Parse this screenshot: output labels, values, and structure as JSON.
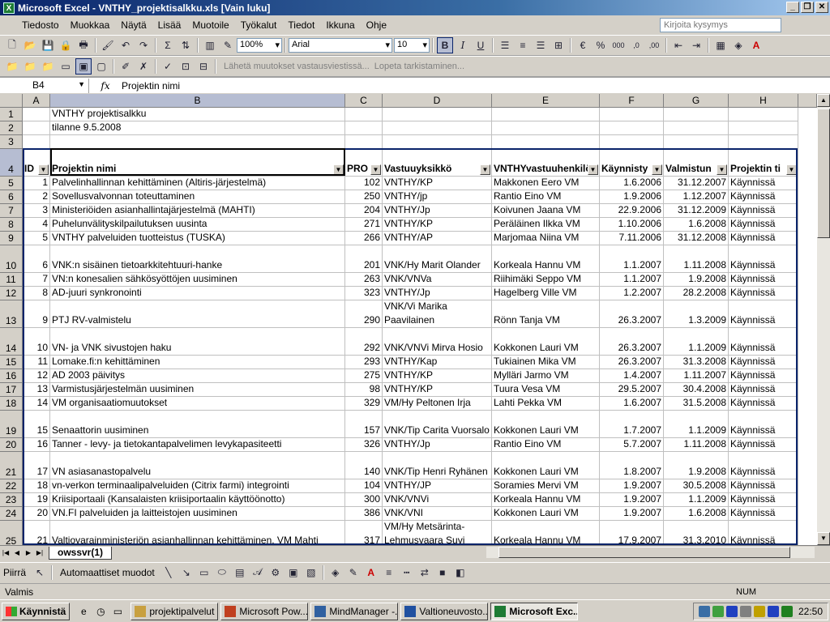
{
  "window": {
    "title": "Microsoft Excel - VNTHY_projektisalkku.xls  [Vain luku]"
  },
  "menu": {
    "items": [
      "Tiedosto",
      "Muokkaa",
      "Näytä",
      "Lisää",
      "Muotoile",
      "Työkalut",
      "Tiedot",
      "Ikkuna",
      "Ohje"
    ],
    "ask_placeholder": "Kirjoita kysymys"
  },
  "toolbar": {
    "zoom": "100%",
    "font": "Arial",
    "size": "10"
  },
  "review": {
    "send_label": "Lähetä muutokset vastausviestissä...",
    "end_label": "Lopeta tarkistaminen..."
  },
  "formula": {
    "cell_ref": "B4",
    "fx": "fx",
    "content": "Projektin nimi"
  },
  "columns": [
    "A",
    "B",
    "C",
    "D",
    "E",
    "F",
    "G",
    "H"
  ],
  "sheet": {
    "title": "VNTHY projektisalkku",
    "date": "tilanne 9.5.2008",
    "headers": [
      "ID",
      "Projektin nimi",
      "PRO",
      "Vastuuyksikkö",
      "VNTHYvastuuhenkilö",
      "Käynnisty",
      "Valmistun",
      "Projektin ti"
    ],
    "rows": [
      {
        "num": "5",
        "id": "1",
        "name": "Palvelinhallinnan kehittäminen (Altiris-järjestelmä)",
        "pro": "102",
        "unit": "VNTHY/KP",
        "person": "Makkonen Eero VM",
        "start": "1.6.2006",
        "end": "31.12.2007",
        "status": "Käynnissä"
      },
      {
        "num": "6",
        "id": "2",
        "name": "Sovellusvalvonnan toteuttaminen",
        "pro": "250",
        "unit": "VNTHY/jp",
        "person": "Rantio Eino VM",
        "start": "1.9.2006",
        "end": "1.12.2007",
        "status": "Käynnissä"
      },
      {
        "num": "7",
        "id": "3",
        "name": "Ministeriöiden asianhallintajärjestelmä (MAHTI)",
        "pro": "204",
        "unit": "VNTHY/Jp",
        "person": "Koivunen Jaana VM",
        "start": "22.9.2006",
        "end": "31.12.2009",
        "status": "Käynnissä"
      },
      {
        "num": "8",
        "id": "4",
        "name": "Puhelunvälityskilpailutuksen uusinta",
        "pro": "271",
        "unit": "VNTHY/KP",
        "person": "Peräläinen Ilkka VM",
        "start": "1.10.2006",
        "end": "1.6.2008",
        "status": "Käynnissä"
      },
      {
        "num": "9",
        "id": "5",
        "name": "VNTHY palveluiden tuotteistus (TUSKA)",
        "pro": "266",
        "unit": "VNTHY/AP",
        "person": "Marjomaa Niina VM",
        "start": "7.11.2006",
        "end": "31.12.2008",
        "status": "Käynnissä"
      },
      {
        "num": "10",
        "id": "6",
        "name": "VNK:n sisäinen tietoarkkitehtuuri-hanke",
        "pro": "201",
        "unit": "VNK/Hy Marit Olander",
        "person": "Korkeala Hannu VM",
        "start": "1.1.2007",
        "end": "1.11.2008",
        "status": "Käynnissä"
      },
      {
        "num": "11",
        "id": "7",
        "name": "VN:n konesalien sähkösyöttöjen uusiminen",
        "pro": "263",
        "unit": "VNK/VNVa",
        "person": "Riihimäki Seppo VM",
        "start": "1.1.2007",
        "end": "1.9.2008",
        "status": "Käynnissä"
      },
      {
        "num": "12",
        "id": "8",
        "name": "AD-juuri synkronointi",
        "pro": "323",
        "unit": "VNTHY/Jp",
        "person": "Hagelberg Ville VM",
        "start": "1.2.2007",
        "end": "28.2.2008",
        "status": "Käynnissä"
      },
      {
        "num": "13",
        "id": "9",
        "name": "PTJ RV-valmistelu",
        "pro": "290",
        "unit": "VNK/Vi Marika Paavilainen",
        "person": "Rönn Tanja VM",
        "start": "26.3.2007",
        "end": "1.3.2009",
        "status": "Käynnissä"
      },
      {
        "num": "14",
        "id": "10",
        "name": "VN- ja VNK sivustojen haku",
        "pro": "292",
        "unit": "VNK/VNVi Mirva Hosio",
        "person": "Kokkonen Lauri VM",
        "start": "26.3.2007",
        "end": "1.1.2009",
        "status": "Käynnissä"
      },
      {
        "num": "15",
        "id": "11",
        "name": "Lomake.fi:n kehittäminen",
        "pro": "293",
        "unit": "VNTHY/Kap",
        "person": "Tukiainen Mika VM",
        "start": "26.3.2007",
        "end": "31.3.2008",
        "status": "Käynnissä"
      },
      {
        "num": "16",
        "id": "12",
        "name": "AD 2003 päivitys",
        "pro": "275",
        "unit": "VNTHY/KP",
        "person": "Mylläri Jarmo VM",
        "start": "1.4.2007",
        "end": "1.11.2007",
        "status": "Käynnissä"
      },
      {
        "num": "17",
        "id": "13",
        "name": "Varmistusjärjestelmän uusiminen",
        "pro": "98",
        "unit": "VNTHY/KP",
        "person": "Tuura Vesa VM",
        "start": "29.5.2007",
        "end": "30.4.2008",
        "status": "Käynnissä"
      },
      {
        "num": "18",
        "id": "14",
        "name": "VM organisaatiomuutokset",
        "pro": "329",
        "unit": "VM/Hy Peltonen Irja",
        "person": "Lahti Pekka VM",
        "start": "1.6.2007",
        "end": "31.5.2008",
        "status": "Käynnissä"
      },
      {
        "num": "19",
        "id": "15",
        "name": "Senaattorin uusiminen",
        "pro": "157",
        "unit": "VNK/Tip Carita Vuorsalo",
        "person": "Kokkonen Lauri VM",
        "start": "1.7.2007",
        "end": "1.1.2009",
        "status": "Käynnissä"
      },
      {
        "num": "20",
        "id": "16",
        "name": "Tanner - levy- ja tietokantapalvelimen levykapasiteetti",
        "pro": "326",
        "unit": "VNTHY/Jp",
        "person": "Rantio Eino VM",
        "start": "5.7.2007",
        "end": "1.11.2008",
        "status": "Käynnissä"
      },
      {
        "num": "21",
        "id": "17",
        "name": "VN asiasanastopalvelu",
        "pro": "140",
        "unit": "VNK/Tip Henri Ryhänen",
        "person": "Kokkonen Lauri VM",
        "start": "1.8.2007",
        "end": "1.9.2008",
        "status": "Käynnissä"
      },
      {
        "num": "22",
        "id": "18",
        "name": "vn-verkon terminaalipalveluiden (Citrix farmi) integrointi",
        "pro": "104",
        "unit": "VNTHY/JP",
        "person": "Soramies Mervi VM",
        "start": "1.9.2007",
        "end": "30.5.2008",
        "status": "Käynnissä"
      },
      {
        "num": "23",
        "id": "19",
        "name": "Kriisiportaali (Kansalaisten kriisiportaalin käyttöönotto)",
        "pro": "300",
        "unit": "VNK/VNVi",
        "person": "Korkeala Hannu VM",
        "start": "1.9.2007",
        "end": "1.1.2009",
        "status": "Käynnissä"
      },
      {
        "num": "24",
        "id": "20",
        "name": "VN.FI palveluiden ja laitteistojen uusiminen",
        "pro": "386",
        "unit": "VNK/VNI",
        "person": "Kokkonen Lauri VM",
        "start": "1.9.2007",
        "end": "1.6.2008",
        "status": "Käynnissä"
      },
      {
        "num": "25",
        "id": "21",
        "name": "Valtiovarainministeriön asianhallinnan kehittäminen, VM Mahti",
        "pro": "317",
        "unit": "VM/Hy Metsärinta-Lehmusvaara Suvi",
        "person": "Korkeala Hannu VM",
        "start": "17.9.2007",
        "end": "31.3.2010",
        "status": "Käynnissä"
      }
    ]
  },
  "sheet_tab": "owssvr(1)",
  "drawing": {
    "draw_label": "Piirrä",
    "autoshapes_label": "Automaattiset muodot"
  },
  "status": {
    "text": "Valmis",
    "num": "NUM"
  },
  "taskbar": {
    "start": "Käynnistä",
    "items": [
      "projektipalvelut",
      "Microsoft Pow...",
      "MindManager -...",
      "Valtioneuvosto...",
      "Microsoft Exc..."
    ],
    "clock": "22:50"
  }
}
